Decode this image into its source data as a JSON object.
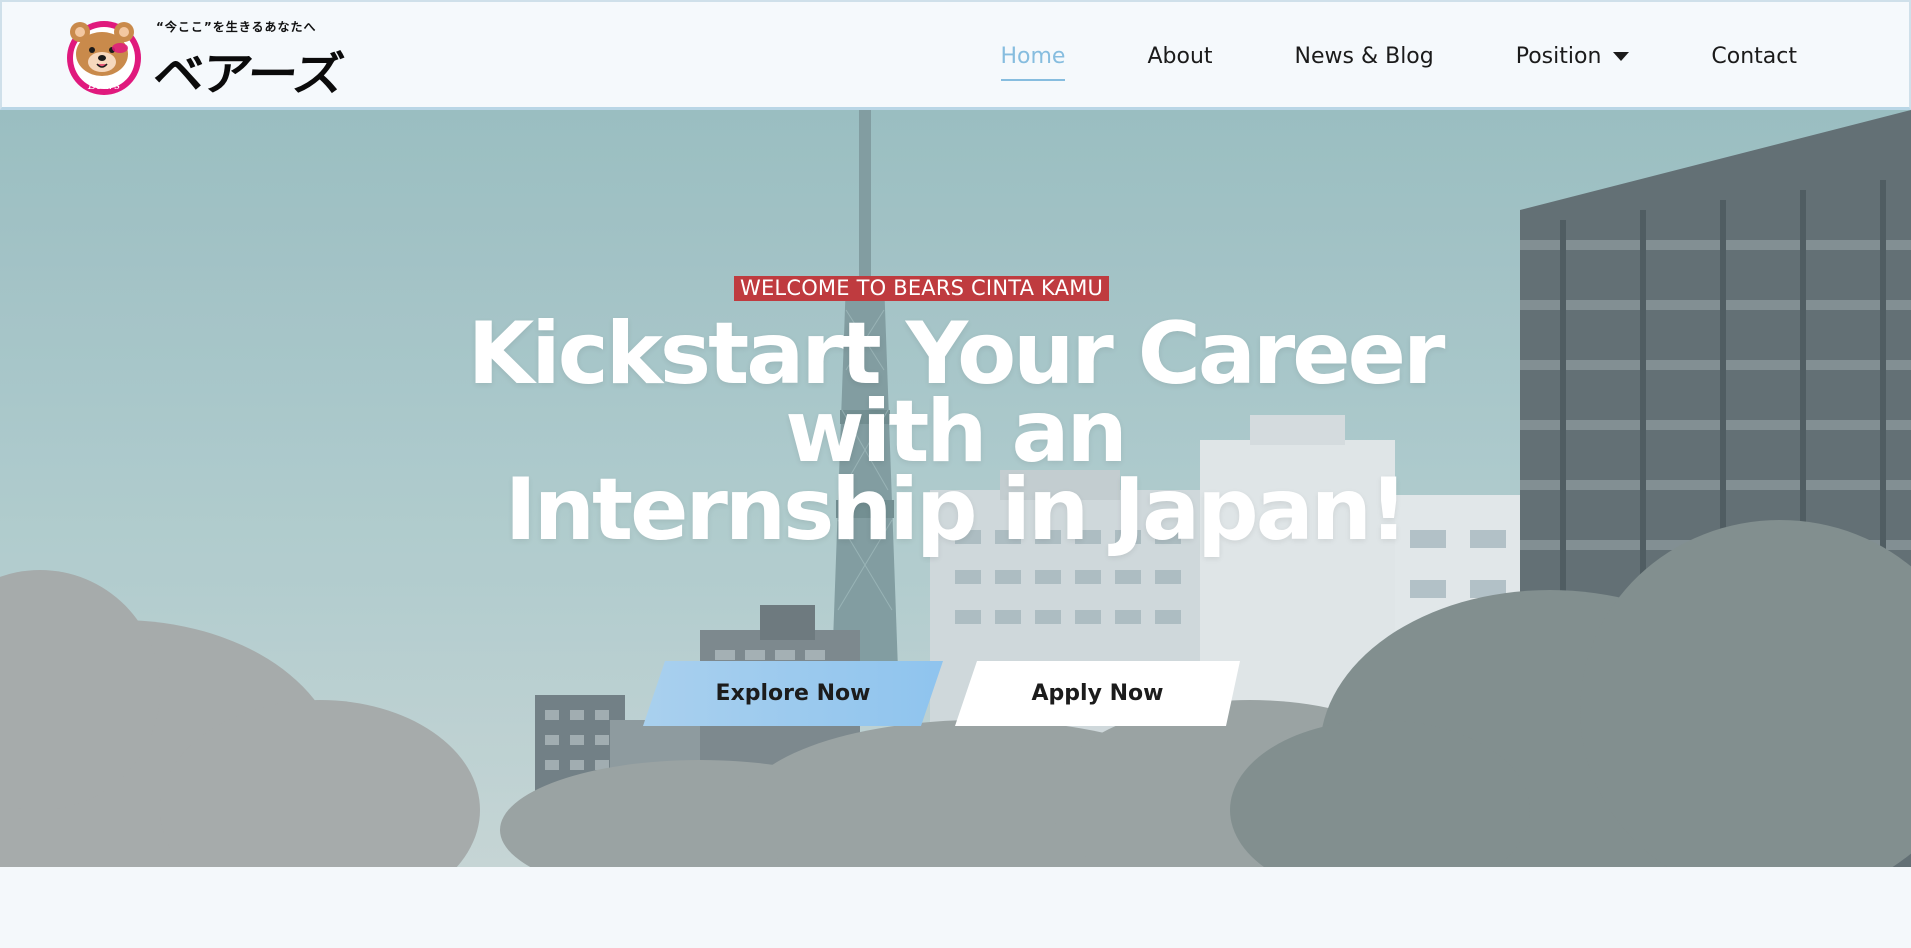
{
  "brand": {
    "tagline": "“今ここ”を生きるあなたへ",
    "wordmark": "ベアーズ",
    "mark_label": "Bears",
    "colors": {
      "ring": "#e0197d",
      "bear": "#c98a4b",
      "accent": "#86bddf"
    }
  },
  "nav": {
    "items": [
      {
        "label": "Home",
        "active": true
      },
      {
        "label": "About",
        "active": false
      },
      {
        "label": "News & Blog",
        "active": false
      },
      {
        "label": "Position",
        "active": false,
        "has_dropdown": true
      },
      {
        "label": "Contact",
        "active": false
      }
    ]
  },
  "hero": {
    "badge": "WELCOME TO BEARS CINTA KAMU",
    "title_lines": [
      "Kickstart Your Career",
      "with an",
      "Internship in Japan!"
    ],
    "buttons": {
      "explore": "Explore Now",
      "apply": "Apply Now"
    },
    "colors": {
      "badge_bg": "#bf3b3f",
      "explore_bg": "#8fc4ee",
      "apply_bg": "#ffffff"
    }
  }
}
